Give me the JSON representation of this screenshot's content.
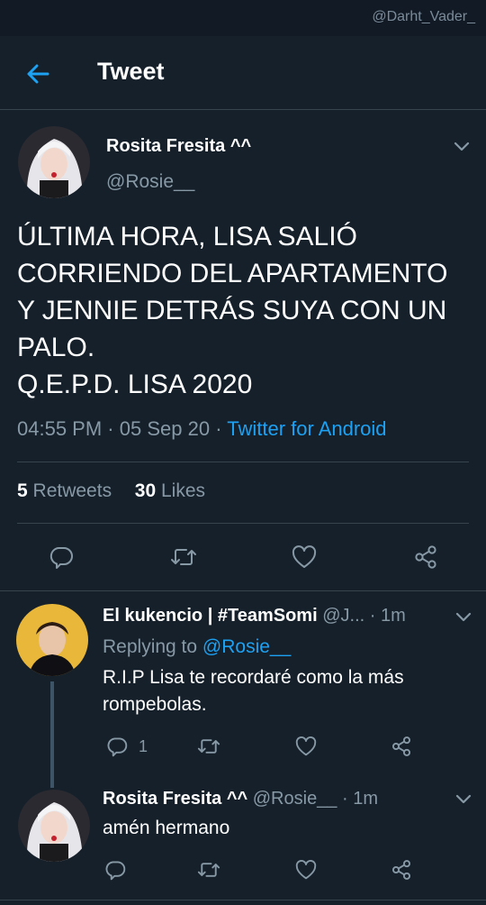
{
  "watermark": "@Darht_Vader_",
  "header": {
    "title": "Tweet"
  },
  "main_tweet": {
    "display_name": "Rosita Fresita ^^",
    "handle": "@Rosie__",
    "text": "ÚLTIMA HORA, LISA SALIÓ\nCORRIENDO DEL APARTAMENTO\nY JENNIE DETRÁS SUYA CON UN\nPALO.\nQ.E.P.D. LISA 2020",
    "time": "04:55 PM",
    "date": "05 Sep 20",
    "separator": "·",
    "source": "Twitter for Android",
    "retweets_count": "5",
    "retweets_label": "Retweets",
    "likes_count": "30",
    "likes_label": "Likes"
  },
  "replies": [
    {
      "display_name": "El kukencio | #TeamSomi",
      "handle": "@J...",
      "age": "1m",
      "replying_prefix": "Replying to",
      "replying_to": "@Rosie__",
      "text": "R.I.P Lisa te recordaré como la más rompebolas.",
      "reply_count": "1"
    },
    {
      "display_name": "Rosita Fresita ^^",
      "handle": "@Rosie__",
      "age": "1m",
      "text": "amén hermano"
    }
  ],
  "icons": {
    "back": "arrow-left-icon",
    "caret": "chevron-down-icon",
    "reply": "reply-icon",
    "retweet": "retweet-icon",
    "like": "heart-icon",
    "share": "share-icon"
  },
  "colors": {
    "background": "#15202b",
    "accent": "#1da1f2",
    "muted": "#8899a6",
    "divider": "#38444d"
  }
}
